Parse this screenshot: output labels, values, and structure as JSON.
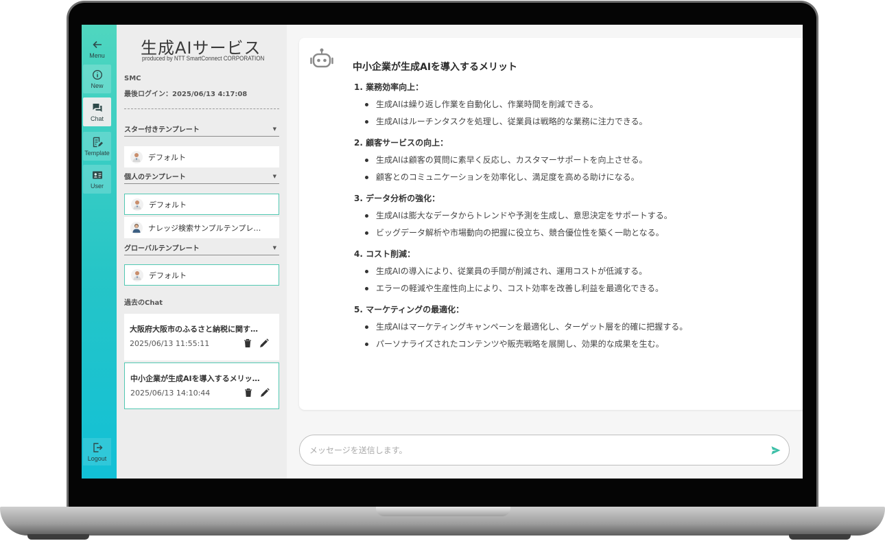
{
  "rail": {
    "menu_label": "Menu",
    "new_label": "New",
    "chat_label": "Chat",
    "template_label": "Template",
    "user_label": "User",
    "logout_label": "Logout"
  },
  "sidebar": {
    "logo_title": "生成AIサービス",
    "logo_sub": "produced by NTT SmartConnect CORPORATION",
    "user_name": "SMC",
    "last_login": "最後ログイン：2025/06/13 4:17:08",
    "starred_heading": "スター付きテンプレート",
    "starred_items": [
      {
        "label": "デフォルト"
      }
    ],
    "personal_heading": "個人のテンプレート",
    "personal_items": [
      {
        "label": "デフォルト"
      },
      {
        "label": "ナレッジ検索サンプルテンプレ…"
      }
    ],
    "global_heading": "グローバルテンプレート",
    "global_items": [
      {
        "label": "デフォルト"
      }
    ],
    "past_chat_heading": "過去のChat",
    "past_chats": [
      {
        "title": "大阪府大阪市のふるさと納税に関す…",
        "date": "2025/06/13 11:55:11"
      },
      {
        "title": "中小企業が生成AIを導入するメリッ…",
        "date": "2025/06/13 14:10:44"
      }
    ]
  },
  "message": {
    "heading": "中小企業が生成AIを導入するメリット",
    "sections": [
      {
        "title": "1. 業務効率向上：",
        "points": [
          "生成AIは繰り返し作業を自動化し、作業時間を削減できる。",
          "生成AIはルーチンタスクを処理し、従業員は戦略的な業務に注力できる。"
        ]
      },
      {
        "title": "2. 顧客サービスの向上：",
        "points": [
          "生成AIは顧客の質問に素早く反応し、カスタマーサポートを向上させる。",
          "顧客とのコミュニケーションを効率化し、満足度を高める助けになる。"
        ]
      },
      {
        "title": "3. データ分析の強化：",
        "points": [
          "生成AIは膨大なデータからトレンドや予測を生成し、意思決定をサポートする。",
          "ビッグデータ解析や市場動向の把握に役立ち、競合優位性を築く一助となる。"
        ]
      },
      {
        "title": "4. コスト削減：",
        "points": [
          "生成AIの導入により、従業員の手間が削減され、運用コストが低減する。",
          "エラーの軽減や生産性向上により、コスト効率を改善し利益を最適化できる。"
        ]
      },
      {
        "title": "5. マーケティングの最適化：",
        "points": [
          "生成AIはマーケティングキャンペーンを最適化し、ターゲット層を的確に把握する。",
          "パーソナライズされたコンテンツや販売戦略を展開し、効果的な成果を生む。"
        ]
      }
    ]
  },
  "input": {
    "placeholder": "メッセージを送信します。"
  },
  "colors": {
    "accent": "#51c8b2",
    "rail_top": "#4fd6bf",
    "rail_bottom": "#12c0d6"
  }
}
